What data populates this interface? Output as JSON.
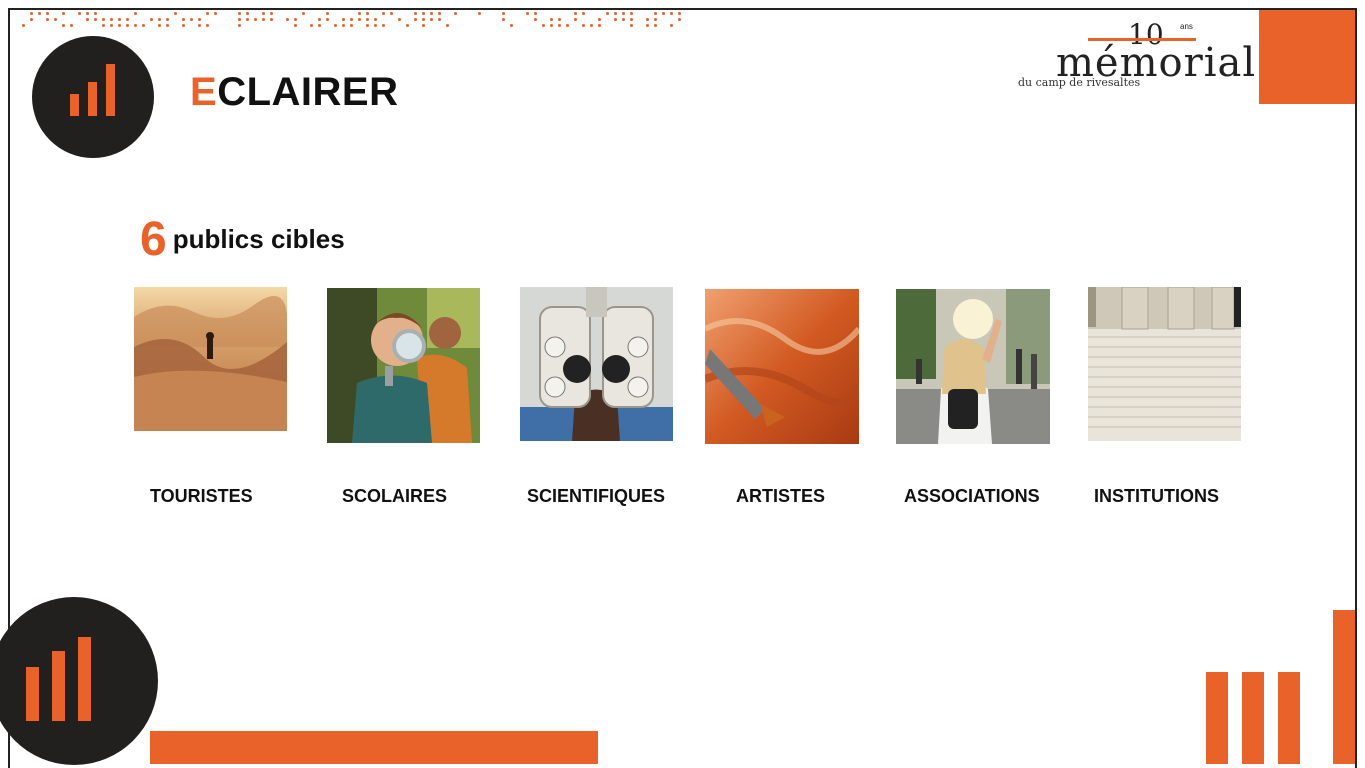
{
  "header": {
    "title_first_letter": "E",
    "title_rest": "CLAIRER"
  },
  "brand": {
    "main": "mémorial",
    "years": "10",
    "years_suffix": "ans",
    "subtitle": "du camp de rivesaltes"
  },
  "section": {
    "count": "6",
    "label": "publics cibles"
  },
  "publics": [
    {
      "label": "TOURISTES",
      "image": "desert-hiker-photo"
    },
    {
      "label": "SCOLAIRES",
      "image": "child-magnifying-glass-photo"
    },
    {
      "label": "SCIENTIFIQUES",
      "image": "phoropter-eye-exam-photo"
    },
    {
      "label": "ARTISTES",
      "image": "orange-paint-brush-photo"
    },
    {
      "label": "ASSOCIATIONS",
      "image": "street-march-photo"
    },
    {
      "label": "INSTITUTIONS",
      "image": "classical-columns-steps-photo"
    }
  ],
  "colors": {
    "accent": "#e8622a",
    "dark": "#221f1f",
    "text": "#111111"
  }
}
